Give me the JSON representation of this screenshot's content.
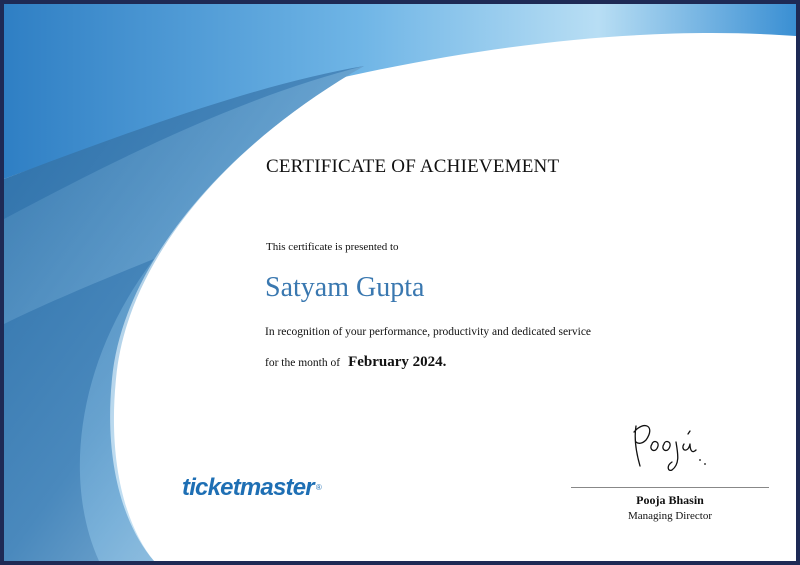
{
  "certificate": {
    "title": "CERTIFICATE OF ACHIEVEMENT",
    "presented_to_text": "This certificate is presented to",
    "recipient_name": "Satyam Gupta",
    "recognition_text": "In recognition of your performance, productivity and dedicated service",
    "month_prefix": "for the month of",
    "month_value": "February 2024.",
    "colors": {
      "border": "#1e2a55",
      "name": "#3a78b0",
      "swoosh_dark": "#2f6b9c",
      "swoosh_light": "#7fc0ea"
    }
  },
  "logo": {
    "text": "ticketmaster",
    "registered_mark": "®",
    "color": "#1e6fb4"
  },
  "signatory": {
    "signature_text": "Pooja",
    "name": "Pooja Bhasin",
    "role": "Managing Director"
  }
}
